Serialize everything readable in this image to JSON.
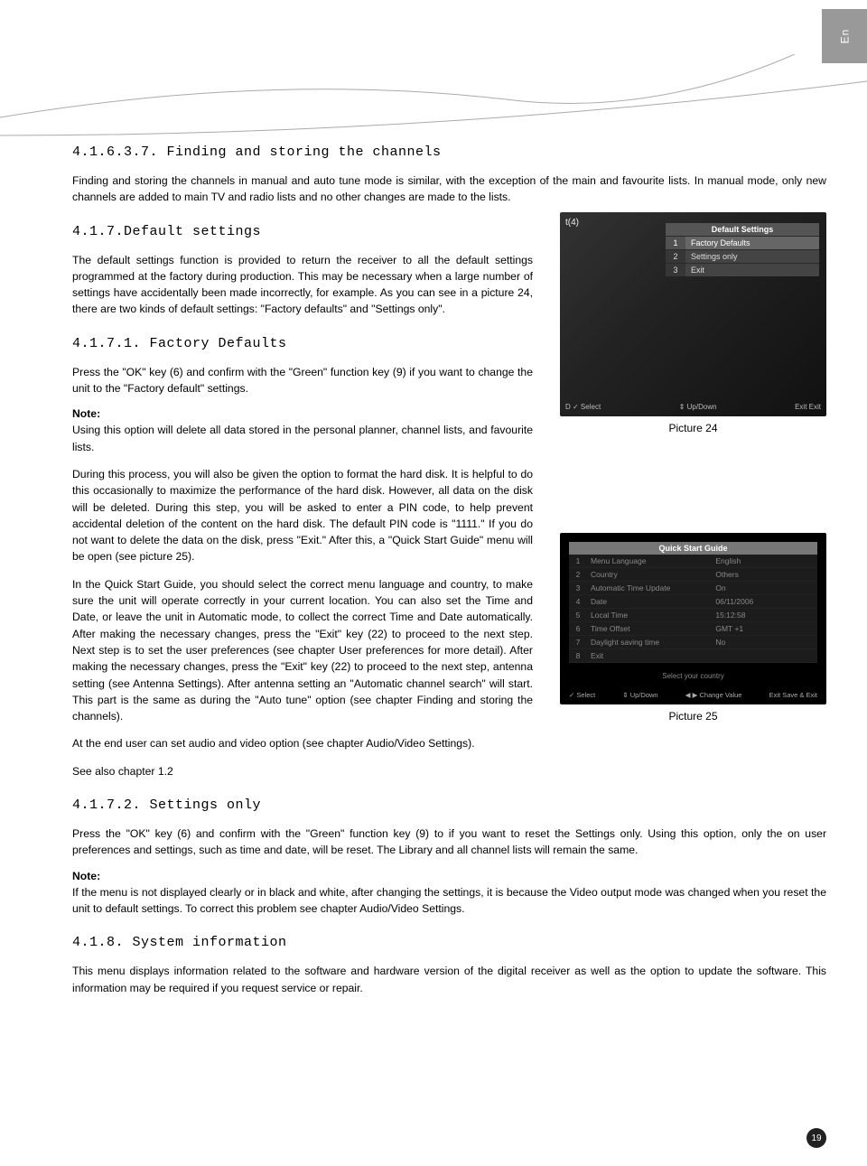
{
  "lang_tab": "En",
  "sections": {
    "s41637_title": "4.1.6.3.7. Finding and storing the channels",
    "s41637_p1": "Finding and storing the channels in manual and auto tune mode is similar, with the exception of the main and favourite lists. In manual mode, only new channels are added to main TV and radio lists and no other changes are made to the lists.",
    "s417_title": "4.1.7.Default settings",
    "s417_p1": "The default settings function is provided to return the receiver to all the default settings programmed at the factory during production. This may be necessary when a large number of settings have accidentally been made incorrectly, for example. As you can see in a picture 24, there are two kinds of default settings: \"Factory defaults\" and \"Settings only\".",
    "s4171_title": "4.1.7.1. Factory Defaults",
    "s4171_p1": "Press the \"OK\" key (6) and confirm with the \"Green\" function key (9) if you want to change the unit to the \"Factory default\" settings.",
    "note_label": "Note:",
    "s4171_note1": "Using this option will delete all data stored in the personal planner, channel lists, and favourite lists.",
    "s4171_p2": "During this process, you will also be given the option to format the hard disk. It is helpful to do this occasionally to maximize the performance of the hard disk. However, all data on the disk will be deleted. During this step, you will be asked to enter a PIN code, to help prevent accidental deletion of the content on the hard disk. The default PIN code is \"1111.\" If you do not want to delete the data on the disk, press \"Exit.\" After this, a \"Quick Start Guide\" menu will be open (see picture 25).",
    "s4171_p3": "In the Quick Start Guide, you should select the correct menu language and country, to make sure the unit will operate correctly in your current location. You can also set the Time and Date, or leave the unit in Automatic mode, to collect the correct Time and Date automatically. After making the necessary changes, press the \"Exit\" key (22) to proceed to the next step. Next step is to set the user preferences (see chapter User preferences for more detail). After making the necessary changes, press the \"Exit\" key (22) to proceed to the next step, antenna setting (see Antenna Settings). After antenna setting an \"Automatic channel search\" will start. This part is the same as during the \"Auto tune\" option (see chapter Finding and storing the channels).",
    "s4171_p4": "At the end user can set audio and video option (see chapter Audio/Video Settings).",
    "s4171_p5": "See also chapter 1.2",
    "s4172_title": "4.1.7.2. Settings only",
    "s4172_p1": "Press the \"OK\" key (6) and confirm with the \"Green\" function key (9) to if you want to reset the Settings only. Using this option, only the on user preferences and settings, such as time and date, will be reset.  The Library and all channel lists will remain the same.",
    "s4172_note1": "If the menu is not displayed clearly or in black and white, after changing the settings, it is because the Video output mode was changed when you reset the unit to default settings.  To correct this problem see chapter Audio/Video Settings.",
    "s418_title": "4.1.8. System information",
    "s418_p1": "This menu displays information related to the software and hardware version of the digital receiver as well as the option to update the software.  This information may be required if you request service or repair."
  },
  "figure24": {
    "caption": "Picture 24",
    "corner": "t(4)",
    "header": "Default Settings",
    "rows": [
      {
        "n": "1",
        "label": "Factory Defaults",
        "hi": true
      },
      {
        "n": "2",
        "label": "Settings only",
        "hi": false
      },
      {
        "n": "3",
        "label": "Exit",
        "hi": false
      }
    ],
    "footer": {
      "a": "D ✓ Select",
      "b": "⇕ Up/Down",
      "c": "Exit Exit"
    }
  },
  "figure25": {
    "caption": "Picture 25",
    "header": "Quick Start Guide",
    "rows": [
      {
        "n": "1",
        "label": "Menu Language",
        "value": "English"
      },
      {
        "n": "2",
        "label": "Country",
        "value": "Others"
      },
      {
        "n": "3",
        "label": "Automatic Time Update",
        "value": "On"
      },
      {
        "n": "4",
        "label": "Date",
        "value": "06/11/2006"
      },
      {
        "n": "5",
        "label": "Local Time",
        "value": "15:12:58"
      },
      {
        "n": "6",
        "label": "Time Offset",
        "value": "GMT +1"
      },
      {
        "n": "7",
        "label": "Daylight saving time",
        "value": "No"
      },
      {
        "n": "8",
        "label": "Exit",
        "value": ""
      }
    ],
    "subtext": "Select your country",
    "footer": {
      "a": "✓ Select",
      "b": "⇕ Up/Down",
      "c": "◀ ▶ Change Value",
      "d": "Exit Save & Exit"
    }
  },
  "page_number": "19"
}
